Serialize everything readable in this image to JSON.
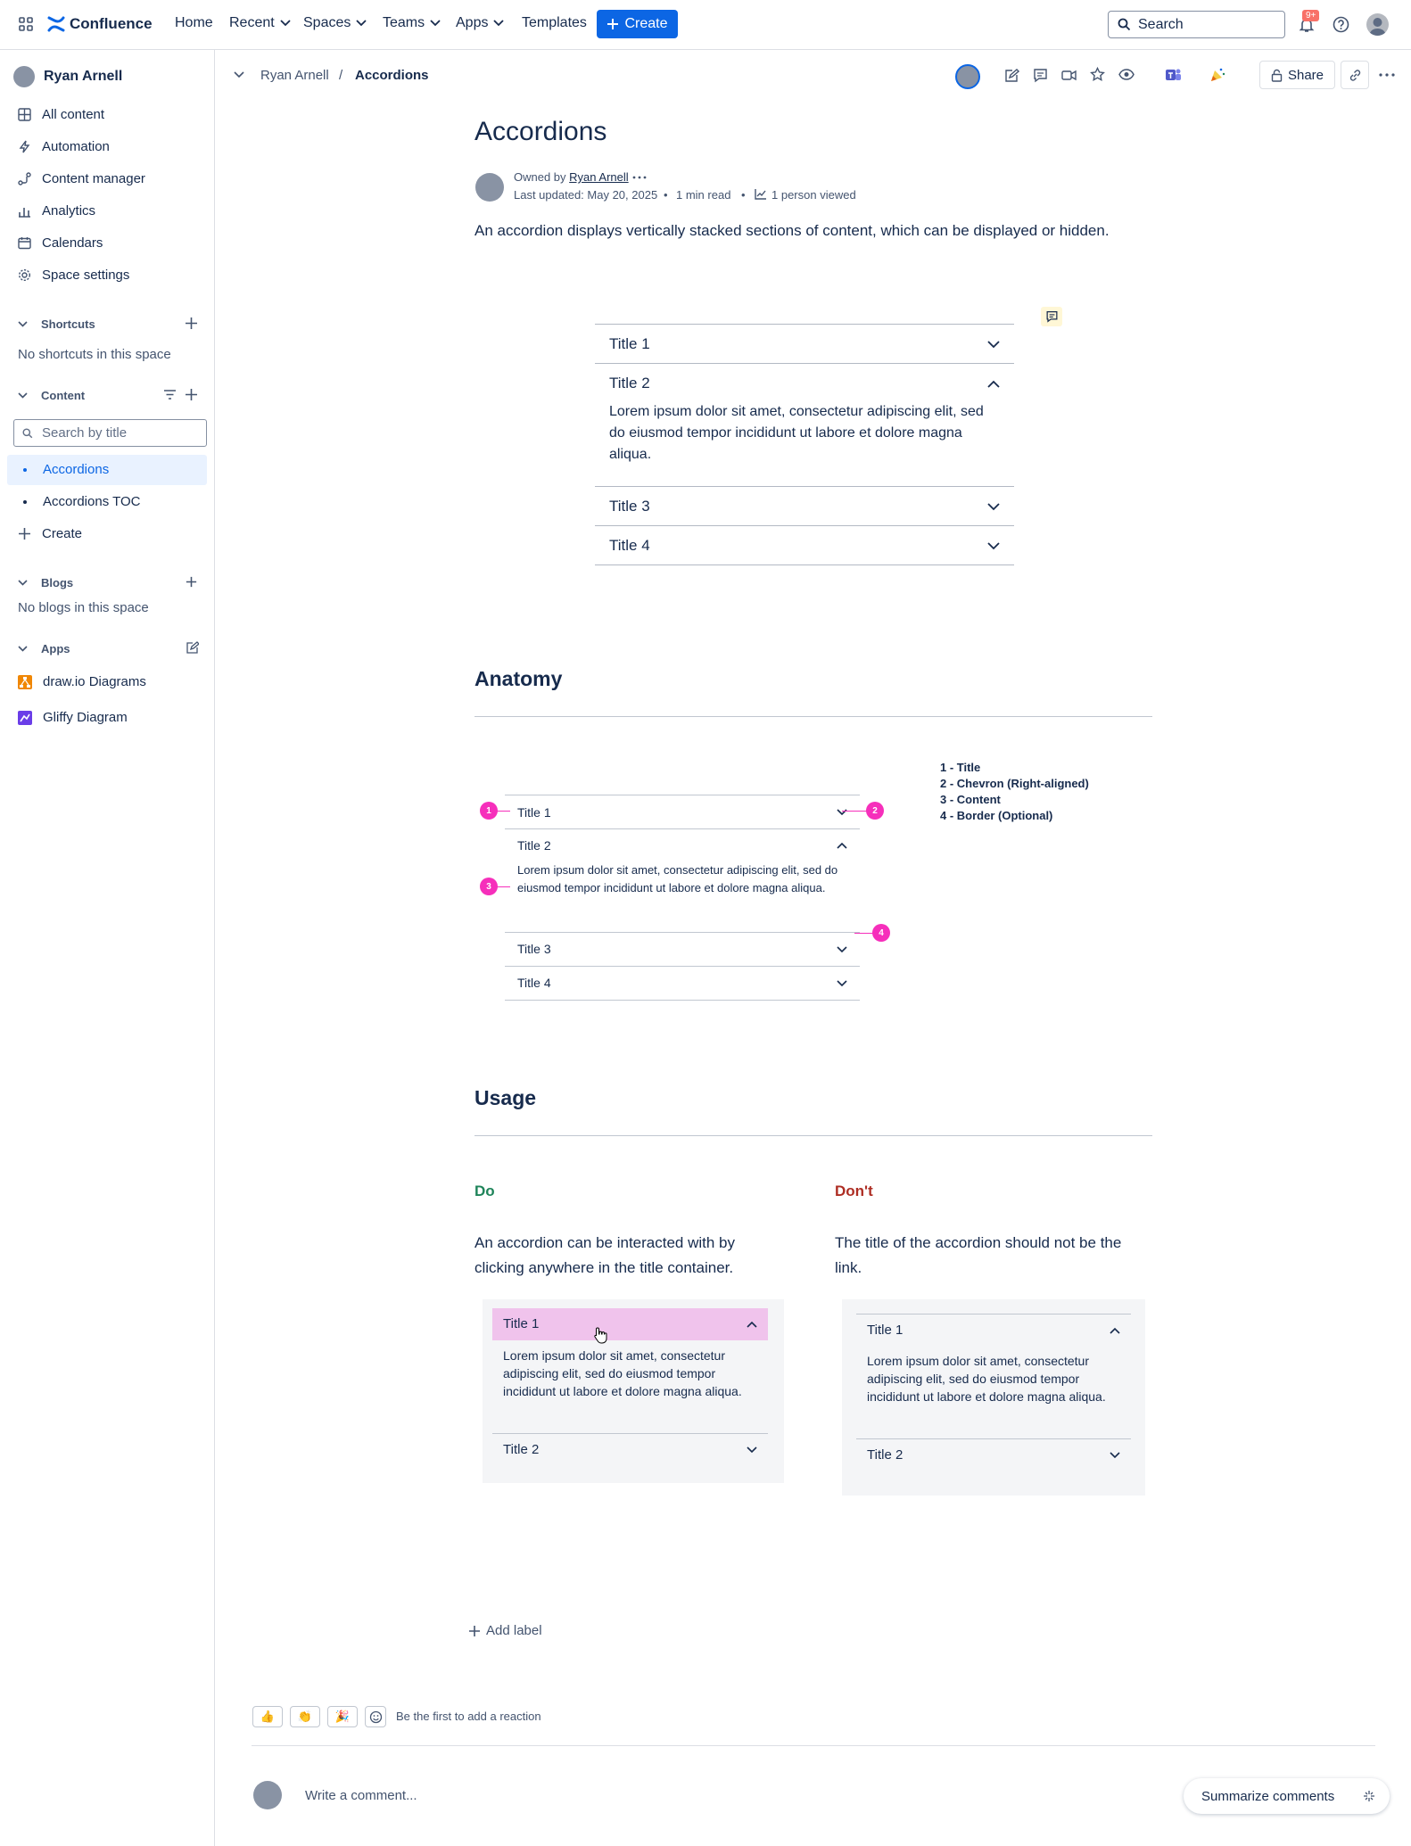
{
  "nav": {
    "brand": "Confluence",
    "links": [
      "Home",
      "Recent",
      "Spaces",
      "Teams",
      "Apps",
      "Templates"
    ],
    "create_label": "Create",
    "search_placeholder": "Search",
    "notifications_badge": "9+"
  },
  "sidebar": {
    "space_owner": "Ryan Arnell",
    "items": [
      "All content",
      "Automation",
      "Content manager",
      "Analytics",
      "Calendars",
      "Space settings"
    ],
    "shortcuts_heading": "Shortcuts",
    "shortcuts_empty": "No shortcuts in this space",
    "content_heading": "Content",
    "search_placeholder": "Search by title",
    "pages": [
      "Accordions",
      "Accordions TOC"
    ],
    "create_label": "Create",
    "blogs_heading": "Blogs",
    "blogs_empty": "No blogs in this space",
    "apps_heading": "Apps",
    "apps": [
      "draw.io Diagrams",
      "Gliffy Diagram"
    ]
  },
  "breadcrumb": {
    "parent": "Ryan Arnell",
    "current": "Accordions",
    "separator": "/"
  },
  "toolbar": {
    "share_label": "Share"
  },
  "page": {
    "title": "Accordions",
    "owned_by_prefix": "Owned by",
    "owner": "Ryan Arnell",
    "last_updated": "Last updated: May 20, 2025",
    "read_time": "1 min read",
    "viewed": "1 person viewed",
    "intro": "An accordion displays vertically stacked sections of content, which can be displayed or hidden."
  },
  "accordion_example": {
    "titles": [
      "Title 1",
      "Title 2",
      "Title 3",
      "Title 4"
    ],
    "content": "Lorem ipsum dolor sit amet, consectetur adipiscing elit, sed do eiusmod tempor incididunt ut labore et dolore magna aliqua."
  },
  "anatomy": {
    "heading": "Anatomy",
    "titles": [
      "Title 1",
      "Title 2",
      "Title 3",
      "Title 4"
    ],
    "content": "Lorem ipsum dolor sit amet, consectetur adipiscing elit, sed do eiusmod tempor incididunt ut labore et dolore magna aliqua.",
    "pins": [
      "1",
      "2",
      "3",
      "4"
    ],
    "legend": [
      "1 -  Title",
      "2 - Chevron (Right-aligned)",
      "3 - Content",
      "4 - Border (Optional)"
    ]
  },
  "usage": {
    "heading": "Usage",
    "do": {
      "label": "Do",
      "text": "An accordion can be interacted with by clicking anywhere in the title container.",
      "title1": "Title 1",
      "title2": "Title 2",
      "content": "Lorem ipsum dolor sit amet, consectetur adipiscing elit, sed do eiusmod tempor incididunt ut labore et dolore magna aliqua."
    },
    "dont": {
      "label": "Don't",
      "text": "The title of the accordion should not be the link.",
      "title1": "Title 1",
      "title2": "Title 2",
      "content": "Lorem ipsum dolor sit amet, consectetur adipiscing elit, sed do eiusmod tempor incididunt ut labore et dolore magna aliqua."
    }
  },
  "footer": {
    "add_label": "Add label",
    "reaction_prompt": "Be the first to add a reaction",
    "comment_placeholder": "Write a comment...",
    "summarize_label": "Summarize comments"
  },
  "colors": {
    "brand_blue": "#0c66e4",
    "pin_pink": "#f62fbb",
    "do_green": "#1f845a",
    "dont_red": "#ae2e24",
    "hover_pink": "#f0c3ec"
  }
}
